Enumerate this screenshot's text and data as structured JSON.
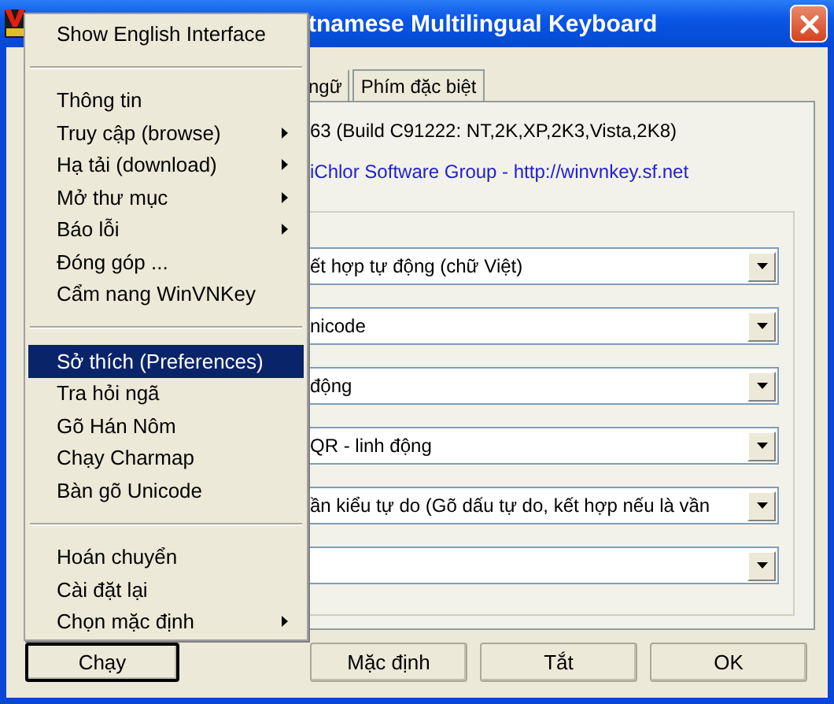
{
  "window": {
    "title": "tnamese Multilingual Keyboard"
  },
  "tabs": [
    {
      "label": "ngữ",
      "selected": false
    },
    {
      "label": "Phím đặc biệt",
      "selected": false
    }
  ],
  "version_text": "63 (Build C91222: NT,2K,XP,2K3,Vista,2K8)",
  "link_text": "iChlor Software Group - http://winvnkey.sf.net",
  "dropdowns": [
    {
      "kind": "combo",
      "value": "ết hợp tự động (chữ Việt)"
    },
    {
      "kind": "combo",
      "value": "nicode"
    },
    {
      "kind": "combo",
      "value": "động"
    },
    {
      "kind": "combo",
      "value": "QR - linh động"
    },
    {
      "kind": "combo",
      "value": "ần kiểu tự do (Gõ dấu tự do, kết hợp nếu là vần"
    },
    {
      "kind": "combo"
    }
  ],
  "buttons": [
    {
      "label": "Chạy",
      "focused": true
    },
    {
      "label": "Mặc định",
      "focused": false
    },
    {
      "label": "Tắt",
      "focused": false
    },
    {
      "label": "OK",
      "focused": false
    }
  ],
  "menu": {
    "items": [
      {
        "kind": "item",
        "label": "Show English Interface",
        "selected": false,
        "submenu": false
      },
      {
        "kind": "separator"
      },
      {
        "kind": "item",
        "label": "Thông tin",
        "selected": false,
        "submenu": false
      },
      {
        "kind": "item",
        "label": "Truy cập (browse)",
        "selected": false,
        "submenu": true
      },
      {
        "kind": "item",
        "label": "Hạ tải (download)",
        "selected": false,
        "submenu": true
      },
      {
        "kind": "item",
        "label": "Mở thư mục",
        "selected": false,
        "submenu": true
      },
      {
        "kind": "item",
        "label": "Báo lỗi",
        "selected": false,
        "submenu": true
      },
      {
        "kind": "item",
        "label": "Đóng góp ...",
        "selected": false,
        "submenu": false
      },
      {
        "kind": "item",
        "label": "Cẩm nang WinVNKey",
        "selected": false,
        "submenu": false
      },
      {
        "kind": "separator"
      },
      {
        "kind": "item",
        "label": "Sở thích (Preferences)",
        "selected": true,
        "submenu": false
      },
      {
        "kind": "item",
        "label": "Tra hỏi ngã",
        "selected": false,
        "submenu": false
      },
      {
        "kind": "item",
        "label": "Gõ Hán Nôm",
        "selected": false,
        "submenu": false
      },
      {
        "kind": "item",
        "label": "Chạy Charmap",
        "selected": false,
        "submenu": false
      },
      {
        "kind": "item",
        "label": "Bàn gõ Unicode",
        "selected": false,
        "submenu": false
      },
      {
        "kind": "separator"
      },
      {
        "kind": "item",
        "label": "Hoán chuyển",
        "selected": false,
        "submenu": false
      },
      {
        "kind": "item",
        "label": "Cài đặt lại",
        "selected": false,
        "submenu": false
      },
      {
        "kind": "item",
        "label": "Chọn mặc định",
        "selected": false,
        "submenu": true
      }
    ]
  }
}
